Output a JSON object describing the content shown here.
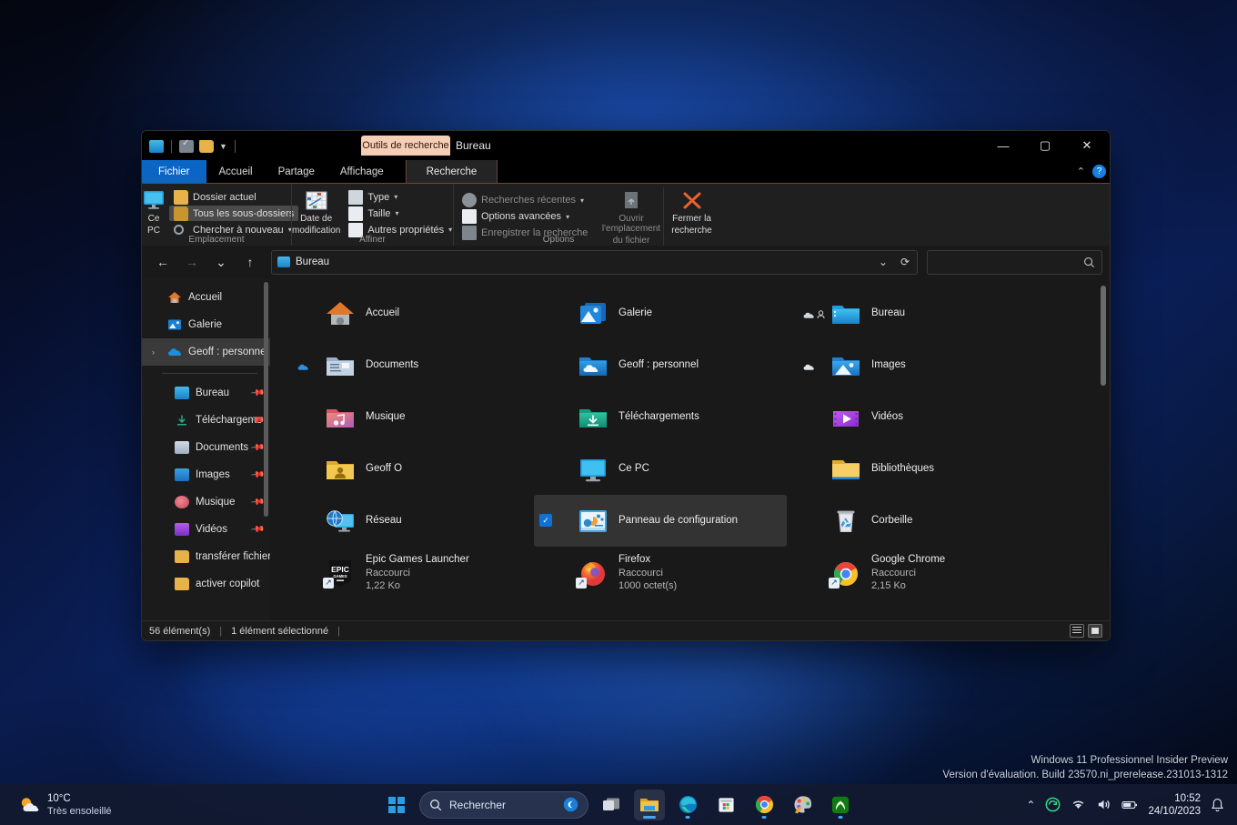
{
  "window": {
    "contextual_tab": "Outils de recherche",
    "title": "Bureau",
    "minimize": "—",
    "maximize": "▢",
    "close": "✕",
    "collapse_ribbon": "⌃",
    "help": "?"
  },
  "tabs": [
    {
      "label": "Fichier",
      "name": "tab-fichier"
    },
    {
      "label": "Accueil",
      "name": "tab-accueil"
    },
    {
      "label": "Partage",
      "name": "tab-partage"
    },
    {
      "label": "Affichage",
      "name": "tab-affichage"
    },
    {
      "label": "Recherche",
      "name": "tab-recherche"
    }
  ],
  "ribbon": {
    "groups": [
      {
        "label": "Emplacement"
      },
      {
        "label": "Affiner"
      },
      {
        "label": "Options"
      }
    ],
    "ce_pc_line1": "Ce",
    "ce_pc_line2": "PC",
    "dossier_actuel": "Dossier actuel",
    "tous_sous_dossiers": "Tous les sous-dossiers",
    "chercher_a_nouveau": "Chercher à nouveau",
    "date_modif_line1": "Date de",
    "date_modif_line2": "modification",
    "type": "Type",
    "taille": "Taille",
    "autres_proprietes": "Autres propriétés",
    "recherches_recentes": "Recherches récentes",
    "options_avancees": "Options avancées",
    "enregistrer_recherche": "Enregistrer la recherche",
    "ouvrir_empl_line1": "Ouvrir l'emplacement",
    "ouvrir_empl_line2": "du fichier",
    "fermer_line1": "Fermer la",
    "fermer_line2": "recherche"
  },
  "navbar": {
    "back": "←",
    "forward": "→",
    "recent": "⌄",
    "up": "↑",
    "address_text": "Bureau",
    "address_dropdown": "⌄",
    "refresh": "⟳",
    "search_value": "",
    "search_placeholder": "",
    "search_icon": "🔍"
  },
  "navpane": {
    "items": [
      {
        "label": "Accueil",
        "icon": "home-icon",
        "indent": false,
        "expander": "",
        "pin": "",
        "selected": false
      },
      {
        "label": "Galerie",
        "icon": "gallery-icon",
        "indent": false,
        "expander": "",
        "pin": "",
        "selected": false
      },
      {
        "label": "Geoff : personnel",
        "icon": "onedrive-icon",
        "indent": false,
        "expander": "›",
        "pin": "",
        "selected": true
      }
    ],
    "items2": [
      {
        "label": "Bureau",
        "icon": "desktop-icon",
        "pin": "📌"
      },
      {
        "label": "Téléchargeme",
        "icon": "download-icon",
        "pin": "📌"
      },
      {
        "label": "Documents",
        "icon": "documents-icon",
        "pin": "📌"
      },
      {
        "label": "Images",
        "icon": "pictures-icon",
        "pin": "📌"
      },
      {
        "label": "Musique",
        "icon": "music-icon",
        "pin": "📌"
      },
      {
        "label": "Vidéos",
        "icon": "videos-icon",
        "pin": "📌"
      },
      {
        "label": "transférer fichier",
        "icon": "folder-icon",
        "pin": ""
      },
      {
        "label": "activer copilot",
        "icon": "folder-icon",
        "pin": ""
      }
    ]
  },
  "files": [
    {
      "name": "Accueil",
      "meta1": "",
      "meta2": "",
      "icon": "home-tile-icon",
      "badge": "",
      "selected": false,
      "shortcut": false
    },
    {
      "name": "Galerie",
      "meta1": "",
      "meta2": "",
      "icon": "gallery-tile-icon",
      "badge": "",
      "selected": false,
      "shortcut": false
    },
    {
      "name": "Bureau",
      "meta1": "",
      "meta2": "",
      "icon": "desktop-folder-icon",
      "badge": "cloud-person",
      "selected": false,
      "shortcut": false
    },
    {
      "name": "Documents",
      "meta1": "",
      "meta2": "",
      "icon": "documents-tile-icon",
      "badge": "cloud",
      "selected": false,
      "shortcut": false
    },
    {
      "name": "Geoff : personnel",
      "meta1": "",
      "meta2": "",
      "icon": "onedrive-tile-icon",
      "badge": "cloud",
      "selected": false,
      "shortcut": false
    },
    {
      "name": "Images",
      "meta1": "",
      "meta2": "",
      "icon": "pictures-tile-icon",
      "badge": "cloud",
      "selected": false,
      "shortcut": false
    },
    {
      "name": "Musique",
      "meta1": "",
      "meta2": "",
      "icon": "music-tile-icon",
      "badge": "",
      "selected": false,
      "shortcut": false
    },
    {
      "name": "Téléchargements",
      "meta1": "",
      "meta2": "",
      "icon": "downloads-tile-icon",
      "badge": "",
      "selected": false,
      "shortcut": false
    },
    {
      "name": "Vidéos",
      "meta1": "",
      "meta2": "",
      "icon": "videos-tile-icon",
      "badge": "",
      "selected": false,
      "shortcut": false
    },
    {
      "name": "Geoff O",
      "meta1": "",
      "meta2": "",
      "icon": "user-folder-icon",
      "badge": "",
      "selected": false,
      "shortcut": false
    },
    {
      "name": "Ce PC",
      "meta1": "",
      "meta2": "",
      "icon": "thispc-tile-icon",
      "badge": "",
      "selected": false,
      "shortcut": false
    },
    {
      "name": "Bibliothèques",
      "meta1": "",
      "meta2": "",
      "icon": "libraries-icon",
      "badge": "",
      "selected": false,
      "shortcut": false
    },
    {
      "name": "Réseau",
      "meta1": "",
      "meta2": "",
      "icon": "network-icon",
      "badge": "",
      "selected": false,
      "shortcut": false
    },
    {
      "name": "Panneau de configuration",
      "meta1": "",
      "meta2": "",
      "icon": "controlpanel-icon",
      "badge": "",
      "selected": true,
      "shortcut": false
    },
    {
      "name": "Corbeille",
      "meta1": "",
      "meta2": "",
      "icon": "recyclebin-icon",
      "badge": "",
      "selected": false,
      "shortcut": false
    },
    {
      "name": "Epic Games Launcher",
      "meta1": "Raccourci",
      "meta2": "1,22 Ko",
      "icon": "epic-icon",
      "badge": "",
      "selected": false,
      "shortcut": true
    },
    {
      "name": "Firefox",
      "meta1": "Raccourci",
      "meta2": "1000 octet(s)",
      "icon": "firefox-icon",
      "badge": "",
      "selected": false,
      "shortcut": true
    },
    {
      "name": "Google Chrome",
      "meta1": "Raccourci",
      "meta2": "2,15 Ko",
      "icon": "chrome-icon",
      "badge": "",
      "selected": false,
      "shortcut": true
    }
  ],
  "status": {
    "count": "56 élément(s)",
    "selected": "1 élément sélectionné",
    "divider": "|",
    "view_list": "list-view-icon",
    "view_tiles": "tiles-view-icon"
  },
  "watermark": {
    "line1": "Windows 11 Professionnel Insider Preview",
    "line2": "Version d'évaluation. Build 23570.ni_prerelease.231013-1312"
  },
  "taskbar": {
    "weather_temp": "10°C",
    "weather_desc": "Très ensoleillé",
    "search_placeholder": "Rechercher",
    "search_icon": "search-icon",
    "start": "start-icon",
    "copilot": "copilot-icon",
    "taskview": "task-view-icon",
    "explorer": "file-explorer-icon",
    "edge": "edge-icon",
    "store": "microsoft-store-icon",
    "chrome": "chrome-icon",
    "paint": "paint-icon",
    "xbox": "xbox-icon",
    "tray_chevron": "⌃",
    "time": "10:52",
    "date": "24/10/2023",
    "notification": "bell-icon"
  },
  "colors": {
    "accent": "#0a65c4",
    "contextual_tab": "#f6cdb5",
    "contextual_border": "#6e4535",
    "selection": "#333333",
    "checkbox": "#0a74d8"
  }
}
